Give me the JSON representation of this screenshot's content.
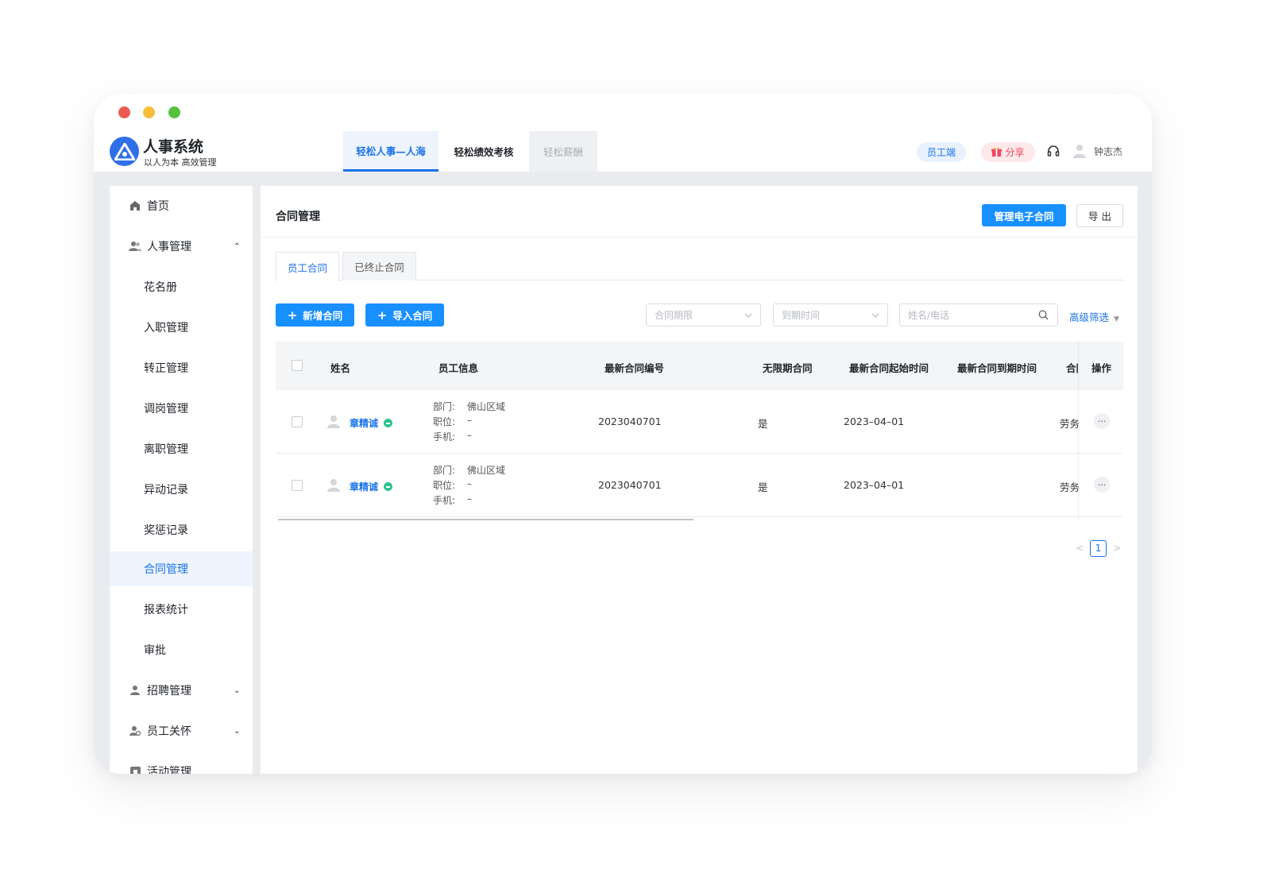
{
  "app": {
    "title": "人事系统",
    "subtitle": "以人为本 高效管理"
  },
  "topnav": [
    {
      "label": "轻松人事—人海",
      "state": "active"
    },
    {
      "label": "轻松绩效考核",
      "state": "normal"
    },
    {
      "label": "轻松薪酬",
      "state": "disabled"
    }
  ],
  "header": {
    "employee_portal": "员工端",
    "share": "分享",
    "user_name": "钟志杰"
  },
  "sidebar": {
    "home": "首页",
    "hr_management": "人事管理",
    "sub_items": [
      "花名册",
      "入职管理",
      "转正管理",
      "调岗管理",
      "离职管理",
      "异动记录",
      "奖惩记录",
      "合同管理",
      "报表统计",
      "审批"
    ],
    "active_item": "合同管理",
    "recruitment": "招聘管理",
    "employee_care": "员工关怀",
    "activities": "活动管理"
  },
  "page": {
    "title": "合同管理",
    "manage_btn": "管理电子合同",
    "export_btn": "导 出",
    "tabs": [
      "员工合同",
      "已终止合同"
    ],
    "add_btn": "新增合同",
    "import_btn": "导入合同",
    "filter_period_placeholder": "合同期限",
    "filter_due_placeholder": "到期时间",
    "search_placeholder": "姓名/电话",
    "advanced_filter": "高级筛选"
  },
  "table": {
    "columns": [
      "姓名",
      "员工信息",
      "最新合同编号",
      "无限期合同",
      "最新合同起始时间",
      "最新合同到期时间",
      "合同",
      "操作"
    ],
    "rows": [
      {
        "name": "章精诚",
        "dept_label": "部门:",
        "dept": "佛山区域",
        "position_label": "职位:",
        "position": "–",
        "phone_label": "手机:",
        "phone": "–",
        "contract_no": "2023040701",
        "indefinite": "是",
        "start_date": "2023–04–01",
        "end_date": "",
        "contract_type": "劳务",
        "more": "···"
      },
      {
        "name": "章精诚",
        "dept_label": "部门:",
        "dept": "佛山区域",
        "position_label": "职位:",
        "position": "–",
        "phone_label": "手机:",
        "phone": "–",
        "contract_no": "2023040701",
        "indefinite": "是",
        "start_date": "2023–04–01",
        "end_date": "",
        "contract_type": "劳务",
        "more": "···"
      }
    ]
  },
  "pagination": {
    "current": "1"
  },
  "colors": {
    "accent": "#1890ff",
    "link": "#1a73e8",
    "online": "#2ec38e",
    "share": "#ef4763"
  }
}
